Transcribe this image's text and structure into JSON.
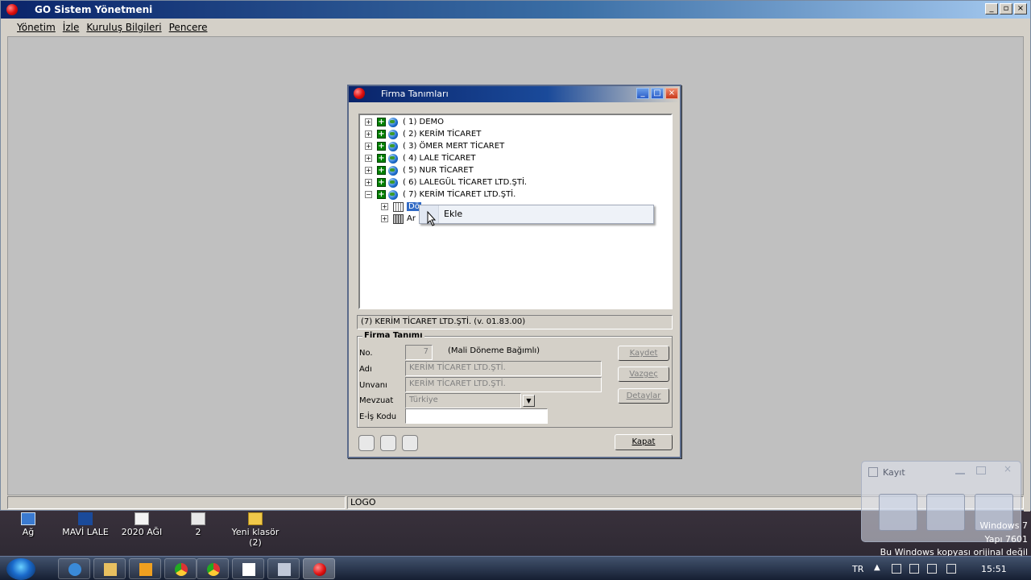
{
  "app": {
    "title": "GO Sistem Yönetmeni",
    "menu": [
      "Yönetim",
      "İzle",
      "Kuruluş Bilgileri",
      "Pencere"
    ],
    "status": [
      "",
      "LOGO"
    ]
  },
  "dialog": {
    "title": "Firma Tanımları",
    "tree": [
      "(  1) DEMO",
      "(  2) KERİM TİCARET",
      "(  3) ÖMER MERT TİCARET",
      "(  4) LALE TİCARET",
      "(  5) NUR TİCARET",
      "(  6) LALEGÜL TİCARET LTD.ŞTİ.",
      "(  7) KERİM TİCARET LTD.ŞTİ."
    ],
    "subitems": [
      "Dö",
      "Ar"
    ],
    "context_menu": [
      "Ekle"
    ],
    "info": "(7) KERİM TİCARET LTD.ŞTİ.  (v. 01.83.00)",
    "group_title": "Firma Tanımı",
    "labels": {
      "no": "No.",
      "adi": "Adı",
      "unvani": "Unvanı",
      "mevzuat": "Mevzuat",
      "eis": "E-İş Kodu"
    },
    "values": {
      "no": "7",
      "mali_donem": "(Mali Döneme Bağımlı)",
      "adi": "KERİM TİCARET LTD.ŞTİ.",
      "unvani": "KERİM TİCARET LTD.ŞTİ.",
      "mevzuat": "Türkiye",
      "eis": ""
    },
    "buttons": {
      "kaydet": "Kaydet",
      "vazgec": "Vazgeç",
      "detaylar": "Detaylar",
      "kapat": "Kapat"
    }
  },
  "desktop": {
    "icons": [
      "Ağ",
      "MAVİ LALE",
      "2020 AĞI",
      "2",
      "Yeni klasör (2)"
    ]
  },
  "kayit": {
    "title": "Kayıt"
  },
  "watermark": {
    "line1": "Windows 7",
    "line2": "Yapı 7601",
    "line3": "Bu Windows kopyası orijinal değil"
  },
  "taskbar": {
    "lang": "TR",
    "time": "15:51"
  }
}
